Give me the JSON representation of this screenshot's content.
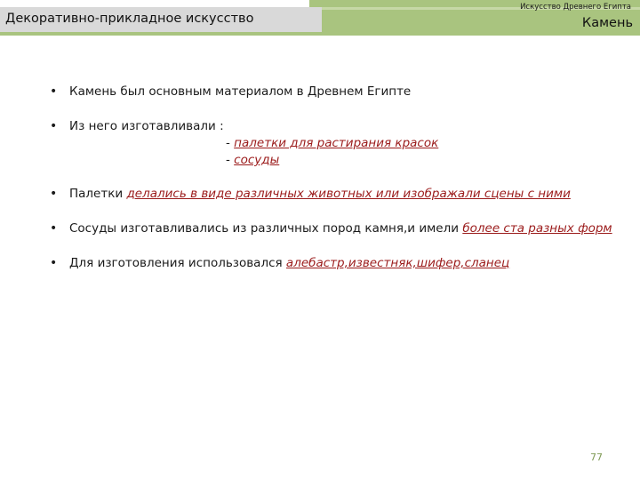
{
  "header": {
    "left_title": "Декоративно-прикладное искусство",
    "right_subtitle": "Искусство Древнего Египта",
    "right_title": "Камень"
  },
  "bullets": {
    "b1_text": "Камень был основным материалом в Древнем Египте",
    "b2_text": "Из него изготавливали :",
    "b2_sub1_prefix": "- ",
    "b2_sub1_link": "палетки для растирания красок",
    "b2_sub2_prefix": "- ",
    "b2_sub2_link": "сосуды",
    "b3_text": "Палетки ",
    "b3_link": "делались в виде различных животных или изображали сцены с ними",
    "b4_text": "Сосуды изготавливались из различных пород камня,и имели ",
    "b4_link": "более ста разных форм",
    "b5_text": "Для изготовления использовался ",
    "b5_link": "алебастр,известняк,шифер,сланец"
  },
  "footer": {
    "page_number": "77"
  },
  "colors": {
    "accent_green": "#a9c47f",
    "header_gray": "#d9d9d9",
    "link_red": "#9b1b1b"
  }
}
